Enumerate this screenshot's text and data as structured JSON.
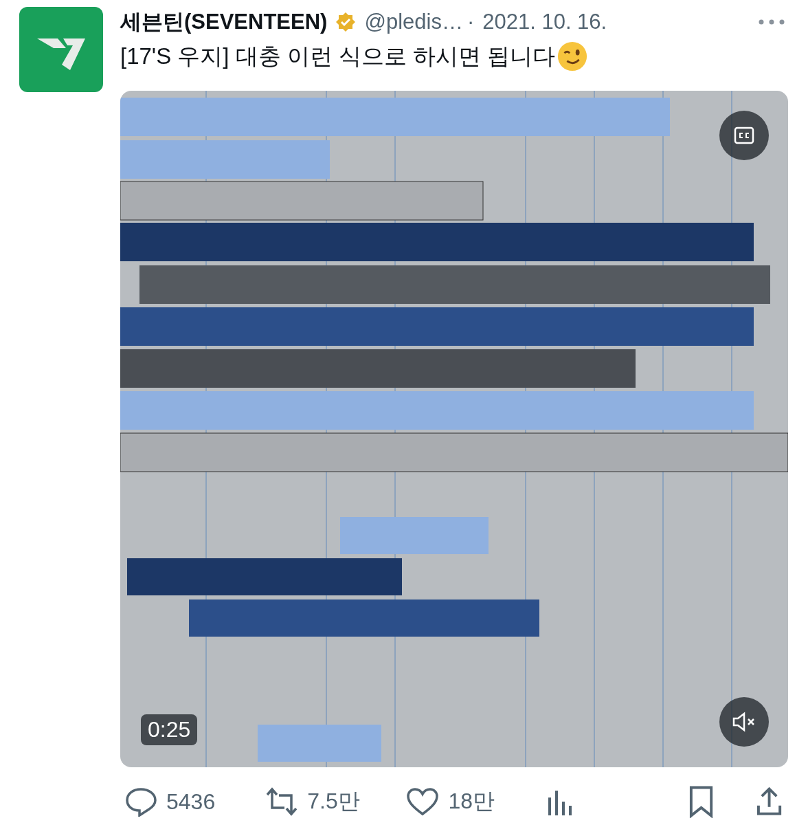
{
  "author": {
    "name": "세븐틴(SEVENTEEN)",
    "verified": true,
    "handle": "@pledis…",
    "separator": "·",
    "date": "2021. 10. 16."
  },
  "text": "[17'S 우지] 대충 이런 식으로 하시면 됩니다",
  "video": {
    "kind": "picture",
    "duration": "0:25",
    "muted": true
  },
  "actions": [
    {
      "kind": "reply",
      "count": "5436"
    },
    {
      "kind": "retweet",
      "count": "7.5만"
    },
    {
      "kind": "like",
      "count": "18만"
    },
    {
      "kind": "views"
    },
    {
      "kind": "bookmark"
    },
    {
      "kind": "share"
    }
  ]
}
